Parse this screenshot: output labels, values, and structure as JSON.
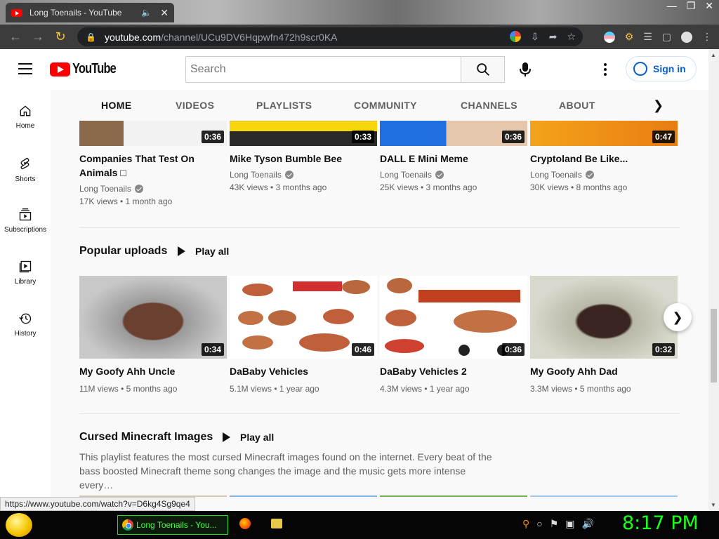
{
  "browser": {
    "tab_title": "Long Toenails - YouTube",
    "url_host": "youtube.com",
    "url_path": "/channel/UCu9DV6Hqpwfn472h9scr0KA",
    "status_url": "https://www.youtube.com/watch?v=D6kg4Sg9qe4"
  },
  "masthead": {
    "logo_text": "YouTube",
    "search_placeholder": "Search",
    "signin_label": "Sign in"
  },
  "sidebar": {
    "items": [
      {
        "label": "Home",
        "icon": "home-icon"
      },
      {
        "label": "Shorts",
        "icon": "shorts-icon"
      },
      {
        "label": "Subscriptions",
        "icon": "subscriptions-icon"
      },
      {
        "label": "Library",
        "icon": "library-icon"
      },
      {
        "label": "History",
        "icon": "history-icon"
      }
    ]
  },
  "channel_tabs": [
    "HOME",
    "VIDEOS",
    "PLAYLISTS",
    "COMMUNITY",
    "CHANNELS",
    "ABOUT"
  ],
  "top_row": [
    {
      "title": "Companies That Test On Animals □",
      "channel": "Long Toenails",
      "meta": "17K views • 1 month ago",
      "duration": "0:36"
    },
    {
      "title": "Mike Tyson Bumble Bee",
      "channel": "Long Toenails",
      "meta": "43K views • 3 months ago",
      "duration": "0:33"
    },
    {
      "title": "DALL E Mini Meme",
      "channel": "Long Toenails",
      "meta": "25K views • 3 months ago",
      "duration": "0:36"
    },
    {
      "title": "Cryptoland Be Like...",
      "channel": "Long Toenails",
      "meta": "30K views • 8 months ago",
      "duration": "0:47"
    }
  ],
  "popular": {
    "title": "Popular uploads",
    "play_all": "Play all",
    "videos": [
      {
        "title": "My Goofy Ahh Uncle",
        "meta": "11M views • 5 months ago",
        "duration": "0:34"
      },
      {
        "title": "DaBaby Vehicles",
        "meta": "5.1M views • 1 year ago",
        "duration": "0:46"
      },
      {
        "title": "DaBaby Vehicles 2",
        "meta": "4.3M views • 1 year ago",
        "duration": "0:36"
      },
      {
        "title": "My Goofy Ahh Dad",
        "meta": "3.3M views • 5 months ago",
        "duration": "0:32"
      }
    ]
  },
  "cursed": {
    "title": "Cursed Minecraft Images",
    "play_all": "Play all",
    "description": "This playlist features the most cursed Minecraft images found on the internet. Every beat of the bass boosted Minecraft theme song changes the image and the music gets more intense every…"
  },
  "taskbar": {
    "chrome_label": "Long Toenails - You...",
    "clock": "8:17 PM"
  }
}
